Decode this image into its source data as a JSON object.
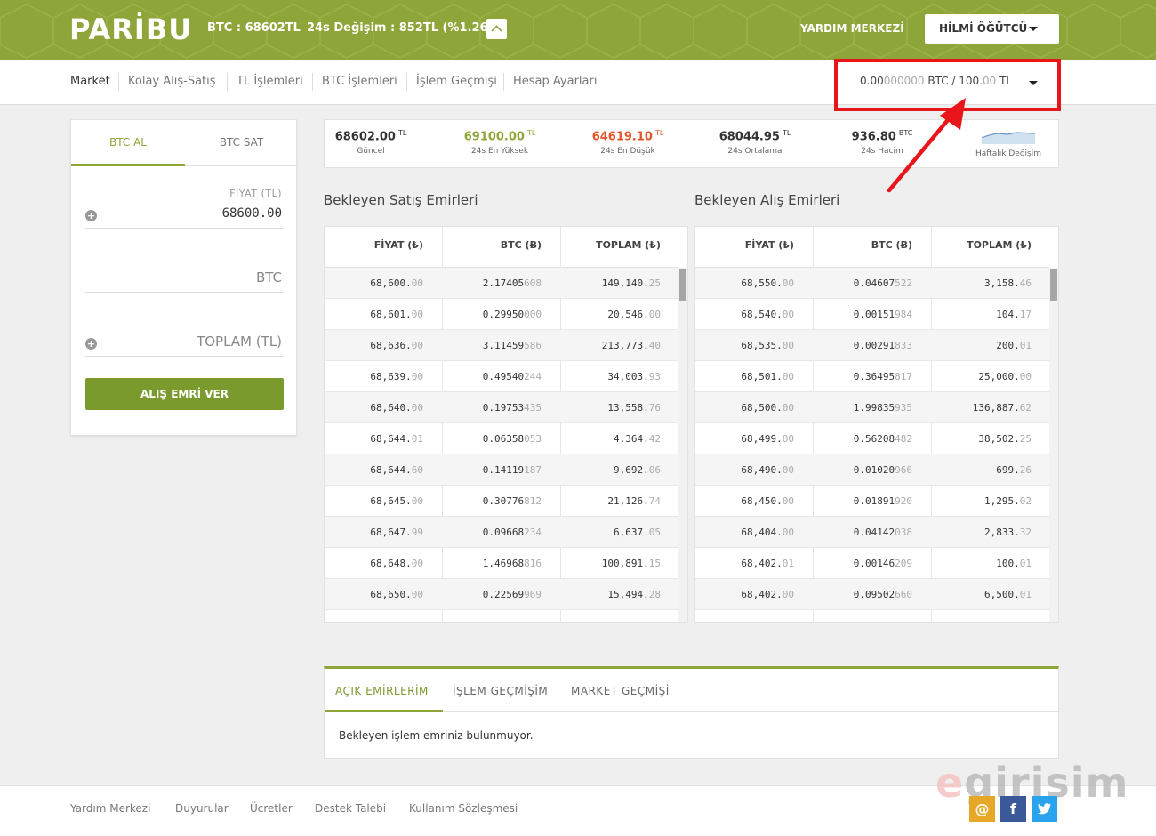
{
  "header": {
    "logo": "PARİBU",
    "ticker": "BTC : 68602TL",
    "change": "24s Değişim : 852TL (%1.26)",
    "help": "YARDIM MERKEZİ",
    "user": "HİLMİ ÖĞÜTCÜ"
  },
  "nav": {
    "items": [
      "Market",
      "Kolay Alış-Satış",
      "TL İşlemleri",
      "BTC İşlemleri",
      "İşlem Geçmişi",
      "Hesap Ayarları"
    ],
    "balance_main": "0.00",
    "balance_dim": "000000",
    "balance_rest": " BTC / 100.",
    "balance_dim2": "00",
    "balance_end": " TL"
  },
  "order_form": {
    "tab_buy": "BTC AL",
    "tab_sell": "BTC SAT",
    "price_label": "FİYAT (TL)",
    "price_value": "68600.00",
    "btc_placeholder": "BTC",
    "total_placeholder": "TOPLAM (TL)",
    "submit": "ALIŞ EMRİ VER"
  },
  "stats": [
    {
      "value": "68602.00",
      "unit": "TL",
      "label": "Güncel",
      "color": "#333333"
    },
    {
      "value": "69100.00",
      "unit": "TL",
      "label": "24s En Yüksek",
      "color": "#8ea53a"
    },
    {
      "value": "64619.10",
      "unit": "TL",
      "label": "24s En Düşük",
      "color": "#e2552a"
    },
    {
      "value": "68044.95",
      "unit": "TL",
      "label": "24s Ortalama",
      "color": "#333333"
    },
    {
      "value": "936.80",
      "unit": "BTC",
      "label": "24s Hacim",
      "color": "#333333"
    },
    {
      "value": "",
      "unit": "",
      "label": "Haftalık Değişim",
      "color": "#333333"
    }
  ],
  "sell_book": {
    "title": "Bekleyen Satış Emirleri",
    "columns": [
      "FİYAT (₺)",
      "BTC (Ƀ)",
      "TOPLAM (₺)"
    ],
    "rows": [
      [
        [
          "68,600.",
          "00"
        ],
        [
          "2.17405",
          "608"
        ],
        [
          "149,140.",
          "25"
        ]
      ],
      [
        [
          "68,601.",
          "00"
        ],
        [
          "0.29950",
          "000"
        ],
        [
          "20,546.",
          "00"
        ]
      ],
      [
        [
          "68,636.",
          "00"
        ],
        [
          "3.11459",
          "586"
        ],
        [
          "213,773.",
          "40"
        ]
      ],
      [
        [
          "68,639.",
          "00"
        ],
        [
          "0.49540",
          "244"
        ],
        [
          "34,003.",
          "93"
        ]
      ],
      [
        [
          "68,640.",
          "00"
        ],
        [
          "0.19753",
          "435"
        ],
        [
          "13,558.",
          "76"
        ]
      ],
      [
        [
          "68,644.",
          "01"
        ],
        [
          "0.06358",
          "053"
        ],
        [
          "4,364.",
          "42"
        ]
      ],
      [
        [
          "68,644.",
          "60"
        ],
        [
          "0.14119",
          "187"
        ],
        [
          "9,692.",
          "06"
        ]
      ],
      [
        [
          "68,645.",
          "00"
        ],
        [
          "0.30776",
          "812"
        ],
        [
          "21,126.",
          "74"
        ]
      ],
      [
        [
          "68,647.",
          "99"
        ],
        [
          "0.09668",
          "234"
        ],
        [
          "6,637.",
          "05"
        ]
      ],
      [
        [
          "68,648.",
          "00"
        ],
        [
          "1.46968",
          "816"
        ],
        [
          "100,891.",
          "15"
        ]
      ],
      [
        [
          "68,650.",
          "00"
        ],
        [
          "0.22569",
          "969"
        ],
        [
          "15,494.",
          "28"
        ]
      ]
    ]
  },
  "buy_book": {
    "title": "Bekleyen Alış Emirleri",
    "columns": [
      "FİYAT (₺)",
      "BTC (Ƀ)",
      "TOPLAM (₺)"
    ],
    "rows": [
      [
        [
          "68,550.",
          "00"
        ],
        [
          "0.04607",
          "522"
        ],
        [
          "3,158.",
          "46"
        ]
      ],
      [
        [
          "68,540.",
          "00"
        ],
        [
          "0.00151",
          "984"
        ],
        [
          "104.",
          "17"
        ]
      ],
      [
        [
          "68,535.",
          "00"
        ],
        [
          "0.00291",
          "833"
        ],
        [
          "200.",
          "01"
        ]
      ],
      [
        [
          "68,501.",
          "00"
        ],
        [
          "0.36495",
          "817"
        ],
        [
          "25,000.",
          "00"
        ]
      ],
      [
        [
          "68,500.",
          "00"
        ],
        [
          "1.99835",
          "935"
        ],
        [
          "136,887.",
          "62"
        ]
      ],
      [
        [
          "68,499.",
          "00"
        ],
        [
          "0.56208",
          "482"
        ],
        [
          "38,502.",
          "25"
        ]
      ],
      [
        [
          "68,490.",
          "00"
        ],
        [
          "0.01020",
          "966"
        ],
        [
          "699.",
          "26"
        ]
      ],
      [
        [
          "68,450.",
          "00"
        ],
        [
          "0.01891",
          "920"
        ],
        [
          "1,295.",
          "02"
        ]
      ],
      [
        [
          "68,404.",
          "00"
        ],
        [
          "0.04142",
          "038"
        ],
        [
          "2,833.",
          "32"
        ]
      ],
      [
        [
          "68,402.",
          "01"
        ],
        [
          "0.00146",
          "209"
        ],
        [
          "100.",
          "01"
        ]
      ],
      [
        [
          "68,402.",
          "00"
        ],
        [
          "0.09502",
          "660"
        ],
        [
          "6,500.",
          "01"
        ]
      ]
    ]
  },
  "bottom": {
    "tabs": [
      "AÇIK EMİRLERİM",
      "İŞLEM GEÇMİŞİM",
      "MARKET GEÇMİŞİ"
    ],
    "empty_message": "Bekleyen işlem emriniz bulunmuyor."
  },
  "footer": {
    "links": [
      "Yardım Merkezi",
      "Duyurular",
      "Ücretler",
      "Destek Talebi",
      "Kullanım Sözleşmesi"
    ],
    "watermark_e": "e",
    "watermark_rest": "girisim",
    "social": [
      "@",
      "f",
      "t"
    ]
  }
}
